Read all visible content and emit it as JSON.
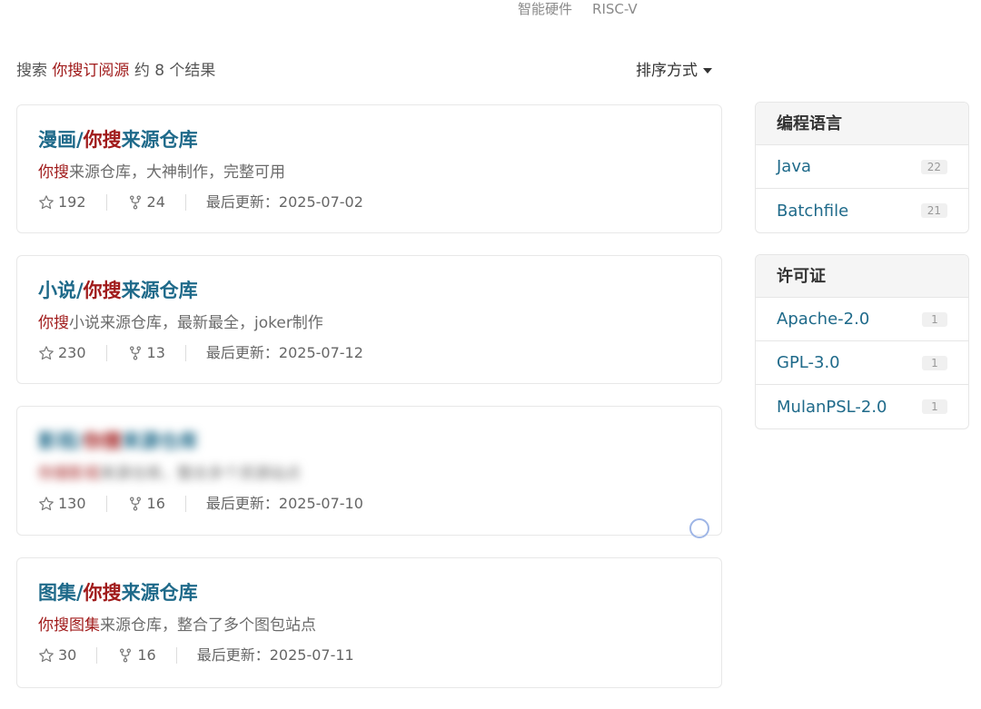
{
  "topnav": [
    "智能硬件",
    "RISC-V"
  ],
  "search": {
    "prefix": "搜索",
    "keyword": "你搜订阅源",
    "suffix": "约 8 个结果",
    "sort_label": "排序方式"
  },
  "results": [
    {
      "title_a": "漫画/",
      "title_b": "你搜",
      "title_c": "来源仓库",
      "desc_hl": "你搜",
      "desc_rest": "来源仓库，大神制作，完整可用",
      "stars": "192",
      "forks": "24",
      "updated": "最后更新：2025-07-02",
      "blurred": false
    },
    {
      "title_a": "小说/",
      "title_b": "你搜",
      "title_c": "来源仓库",
      "desc_hl": "你搜",
      "desc_rest": "小说来源仓库，最新最全，joker制作",
      "stars": "230",
      "forks": "13",
      "updated": "最后更新：2025-07-12",
      "blurred": false
    },
    {
      "title_a": "影视/",
      "title_b": "你搜",
      "title_c": "来源仓库",
      "desc_hl": "你搜影视",
      "desc_rest": "来源仓库，整合多个资源站点",
      "stars": "130",
      "forks": "16",
      "updated": "最后更新：2025-07-10",
      "blurred": true
    },
    {
      "title_a": "图集/",
      "title_b": "你搜",
      "title_c": "来源仓库",
      "desc_hl": "你搜图集",
      "desc_rest": "来源仓库，整合了多个图包站点",
      "stars": "30",
      "forks": "16",
      "updated": "最后更新：2025-07-11",
      "blurred": false
    }
  ],
  "languages": {
    "heading": "编程语言",
    "items": [
      {
        "name": "Java",
        "count": "22"
      },
      {
        "name": "Batchfile",
        "count": "21"
      }
    ]
  },
  "licenses": {
    "heading": "许可证",
    "items": [
      {
        "name": "Apache-2.0",
        "count": "1"
      },
      {
        "name": "GPL-3.0",
        "count": "1"
      },
      {
        "name": "MulanPSL-2.0",
        "count": "1"
      }
    ]
  },
  "colors": {
    "link": "#1f6a8a",
    "highlight": "#a01b1b"
  },
  "icons": {
    "star": "star-icon",
    "fork": "fork-icon",
    "caret": "caret-down-icon"
  }
}
